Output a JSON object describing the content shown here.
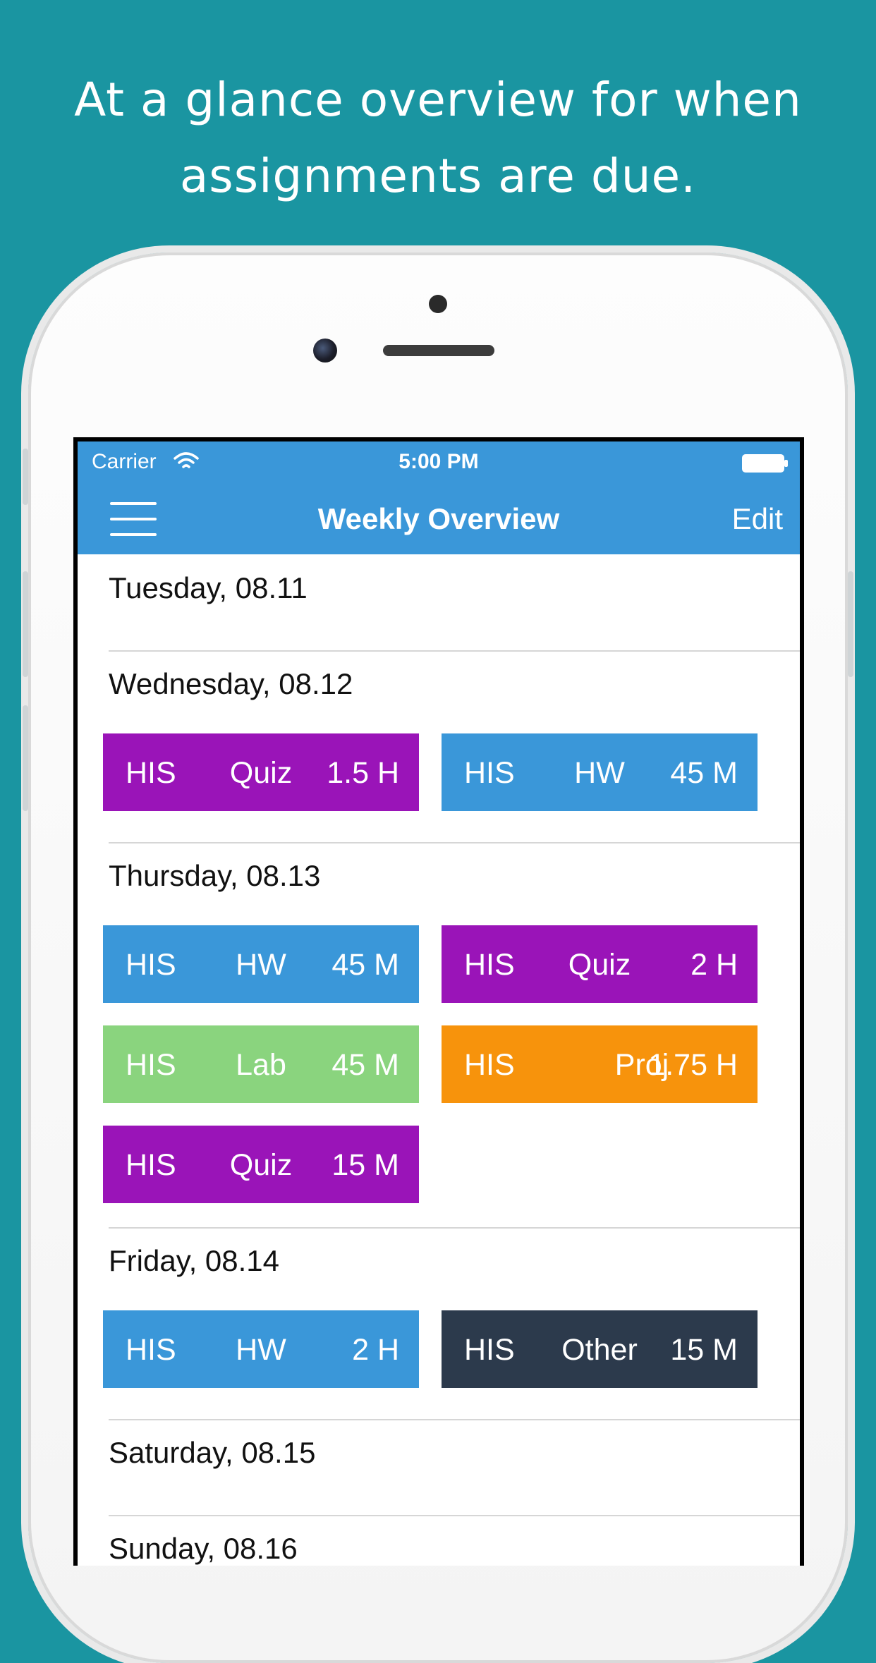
{
  "headline": {
    "line1": "At a glance overview for when",
    "line2": "assignments are due."
  },
  "status_bar": {
    "carrier": "Carrier",
    "time": "5:00 PM"
  },
  "nav": {
    "title": "Weekly Overview",
    "edit_label": "Edit"
  },
  "colors": {
    "background": "#1a95a1",
    "nav": "#3a97d9",
    "hw": "#3a97d9",
    "quiz": "#9a14b8",
    "lab": "#8ad47e",
    "proj": "#f7930c",
    "other": "#2c3a4c"
  },
  "days": [
    {
      "label": "Tuesday, 08.11",
      "items": []
    },
    {
      "label": "Wednesday, 08.12",
      "items": [
        {
          "course": "HIS",
          "type": "Quiz",
          "duration": "1.5 H",
          "color": "#9a14b8"
        },
        {
          "course": "HIS",
          "type": "HW",
          "duration": "45 M",
          "color": "#3a97d9"
        }
      ]
    },
    {
      "label": "Thursday, 08.13",
      "items": [
        {
          "course": "HIS",
          "type": "HW",
          "duration": "45 M",
          "color": "#3a97d9"
        },
        {
          "course": "HIS",
          "type": "Quiz",
          "duration": "2 H",
          "color": "#9a14b8"
        },
        {
          "course": "HIS",
          "type": "Lab",
          "duration": "45 M",
          "color": "#8ad47e"
        },
        {
          "course": "HIS",
          "type": "Proj",
          "duration": "1.75 H",
          "color": "#f7930c"
        },
        {
          "course": "HIS",
          "type": "Quiz",
          "duration": "15 M",
          "color": "#9a14b8"
        }
      ]
    },
    {
      "label": "Friday, 08.14",
      "items": [
        {
          "course": "HIS",
          "type": "HW",
          "duration": "2 H",
          "color": "#3a97d9"
        },
        {
          "course": "HIS",
          "type": "Other",
          "duration": "15 M",
          "color": "#2c3a4c"
        }
      ]
    },
    {
      "label": "Saturday, 08.15",
      "items": []
    },
    {
      "label": "Sunday, 08.16",
      "items": []
    }
  ]
}
